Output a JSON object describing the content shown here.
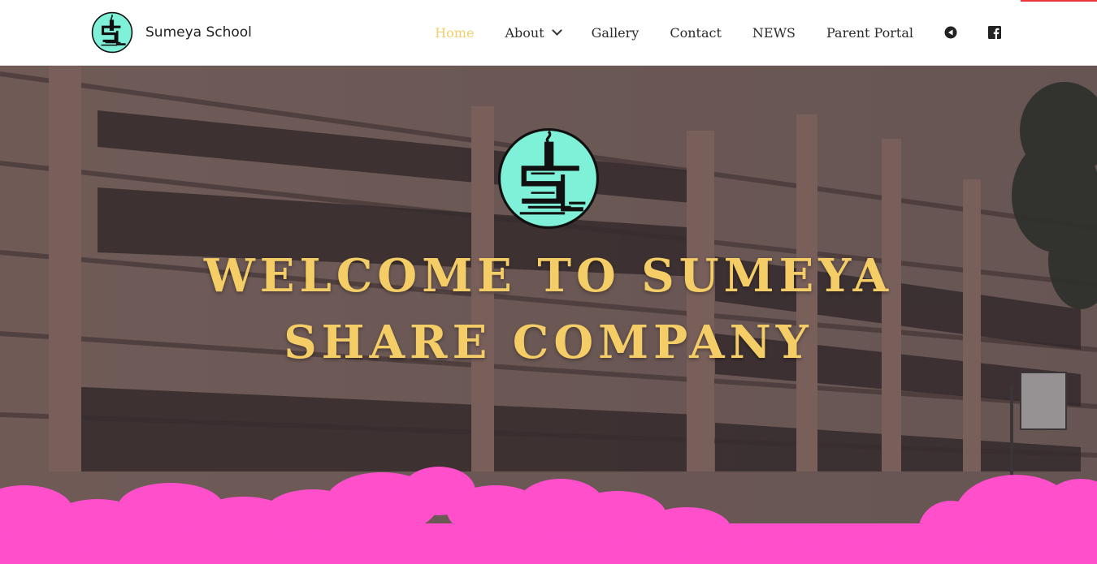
{
  "header": {
    "brand_name": "Sumeya School",
    "nav": [
      {
        "label": "Home",
        "active": true
      },
      {
        "label": "About",
        "has_dropdown": true
      },
      {
        "label": "Gallery"
      },
      {
        "label": "Contact"
      },
      {
        "label": "NEWS"
      },
      {
        "label": "Parent Portal"
      }
    ],
    "icons": [
      "play-back-icon",
      "facebook-icon"
    ]
  },
  "hero": {
    "title": "WELCOME TO SUMEYA SHARE COMPANY"
  },
  "colors": {
    "accent": "#f4cd66",
    "logo_bg": "#7ff1d8",
    "cloud": "#ff4fcb"
  }
}
